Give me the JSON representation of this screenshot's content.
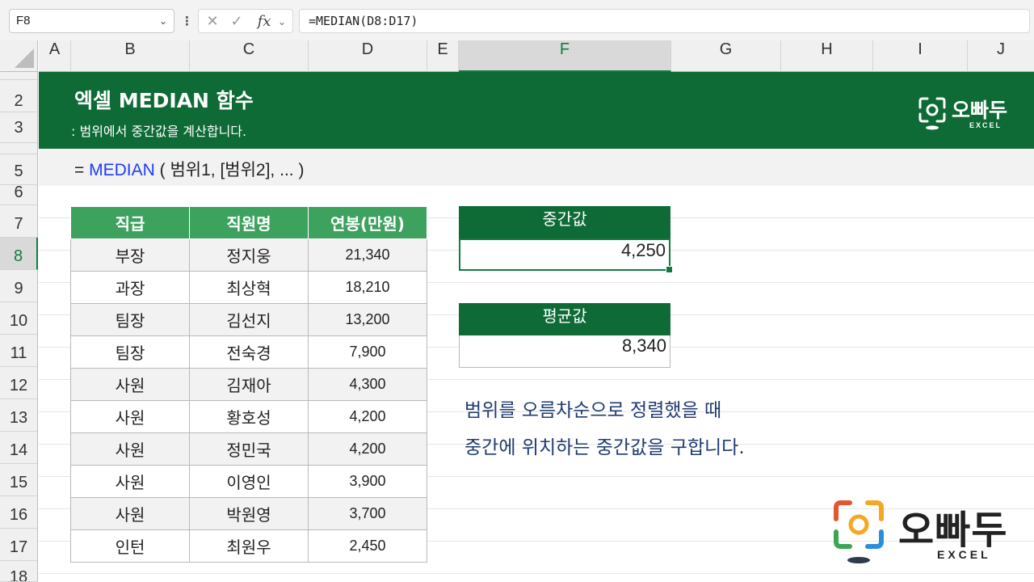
{
  "formula_bar": {
    "name_box": "F8",
    "formula": "=MEDIAN(D8:D17)",
    "icons": [
      "cancel-icon",
      "enter-check-icon",
      "insert-function-icon"
    ]
  },
  "columns": [
    "A",
    "B",
    "C",
    "D",
    "E",
    "F",
    "G",
    "H",
    "I",
    "J"
  ],
  "selected_column": "F",
  "rows": [
    "2",
    "3",
    "5",
    "6",
    "7",
    "8",
    "9",
    "10",
    "11",
    "12",
    "13",
    "14",
    "15",
    "16",
    "17",
    "18"
  ],
  "selected_row": "8",
  "banner": {
    "title": "엑셀 MEDIAN 함수",
    "subtitle": ": 범위에서 중간값을 계산합니다.",
    "logo_name": "오빠두",
    "logo_sub": "EXCEL"
  },
  "syntax": {
    "prefix": "= ",
    "function": "MEDIAN",
    "args": " ( 범위1, [범위2], ... )"
  },
  "table": {
    "headers": [
      "직급",
      "직원명",
      "연봉(만원)"
    ],
    "rows": [
      [
        "부장",
        "정지웅",
        "21,340"
      ],
      [
        "과장",
        "최상혁",
        "18,210"
      ],
      [
        "팀장",
        "김선지",
        "13,200"
      ],
      [
        "팀장",
        "전숙경",
        "7,900"
      ],
      [
        "사원",
        "김재아",
        "4,300"
      ],
      [
        "사원",
        "황호성",
        "4,200"
      ],
      [
        "사원",
        "정민국",
        "4,200"
      ],
      [
        "사원",
        "이영인",
        "3,900"
      ],
      [
        "사원",
        "박원영",
        "3,700"
      ],
      [
        "인턴",
        "최원우",
        "2,450"
      ]
    ]
  },
  "median_box": {
    "label": "중간값",
    "value": "4,250"
  },
  "average_box": {
    "label": "평균값",
    "value": "8,340"
  },
  "note": {
    "line1": "범위를 오름차순으로 정렬했을 때",
    "line2": "중간에 위치하는 중간값을 구합니다."
  },
  "colors": {
    "banner_green": "#0e6b36",
    "header_green": "#3ea25f",
    "syntax_blue": "#1f3df5",
    "note_navy": "#1f3b70"
  }
}
